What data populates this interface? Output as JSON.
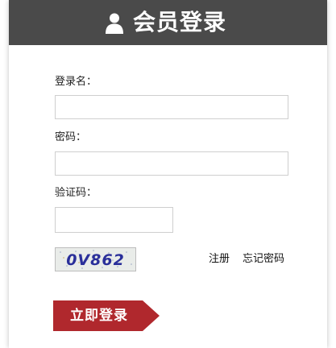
{
  "header": {
    "title": "会员登录",
    "icon": "user-icon",
    "background_color": "#4a4a4a"
  },
  "form": {
    "username_label": "登录名：",
    "username_value": "",
    "password_label": "密码：",
    "password_value": "",
    "captcha_label": "验证码：",
    "captcha_value": "",
    "captcha_image_text": "0V862"
  },
  "links": {
    "register": "注册",
    "forgot_password": "忘记密码"
  },
  "submit": {
    "label": "立即登录",
    "color": "#b0282d"
  }
}
